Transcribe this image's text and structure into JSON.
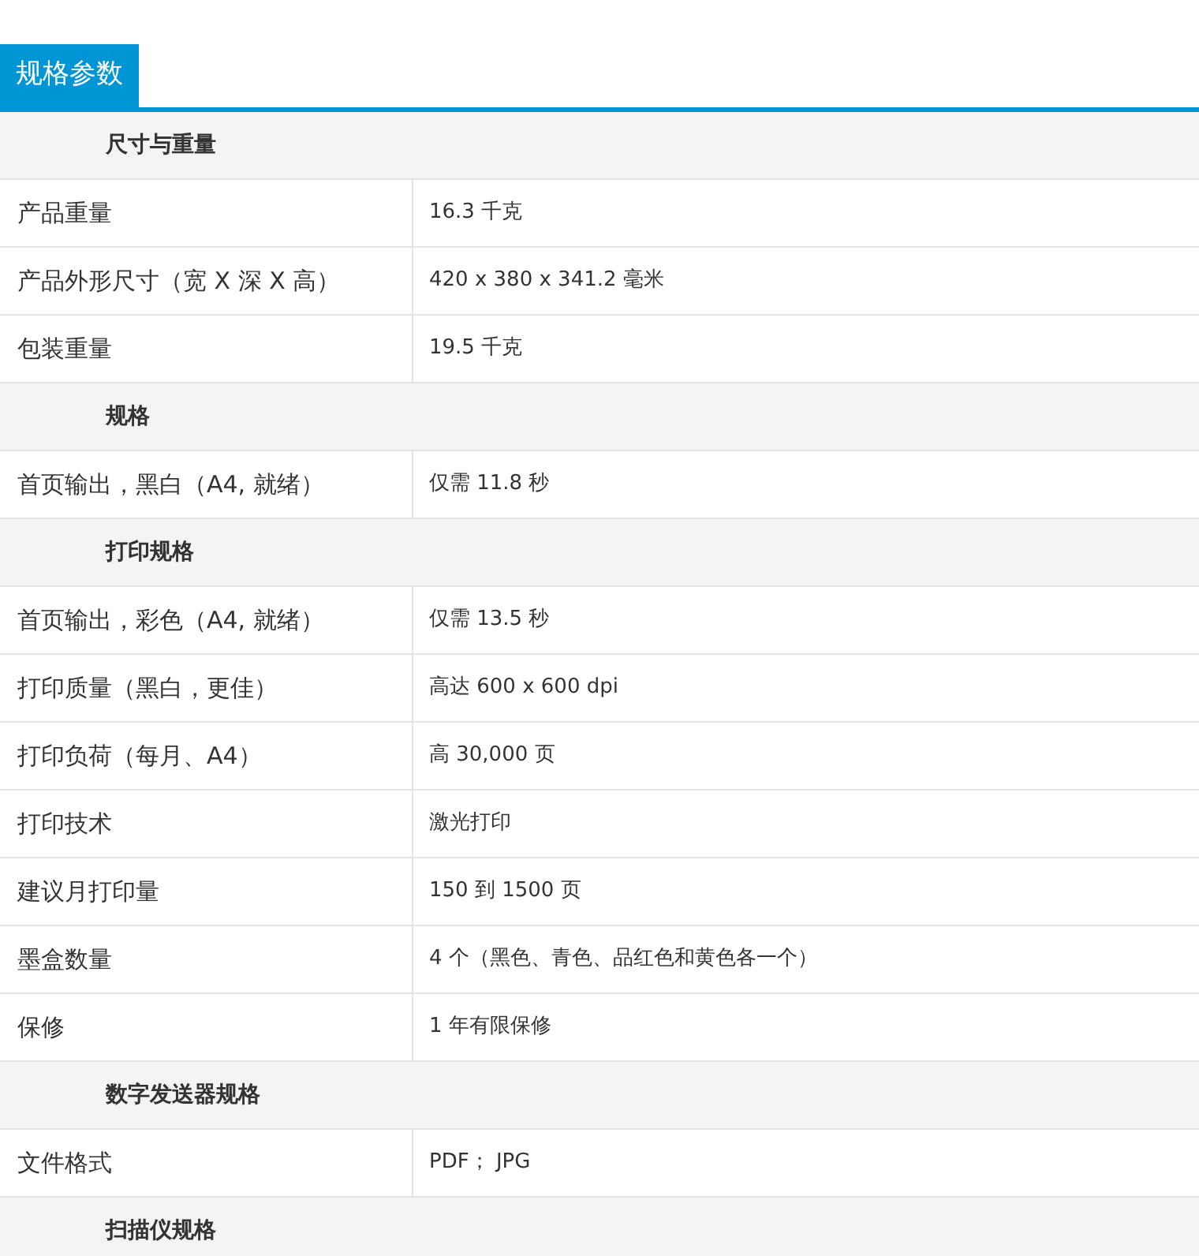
{
  "tab": {
    "label": "规格参数",
    "selected": true
  },
  "sections": [
    {
      "title": "尺寸与重量",
      "rows": [
        {
          "label": "产品重量",
          "value": "16.3 千克"
        },
        {
          "label": "产品外形尺寸（宽 X 深 X 高）",
          "value": "420 x 380 x 341.2 毫米"
        },
        {
          "label": "包装重量",
          "value": "19.5 千克"
        }
      ]
    },
    {
      "title": "规格",
      "rows": [
        {
          "label": "首页输出，黑白（A4, 就绪）",
          "value": "仅需 11.8 秒"
        }
      ]
    },
    {
      "title": "打印规格",
      "rows": [
        {
          "label": "首页输出，彩色（A4, 就绪）",
          "value": "仅需 13.5 秒"
        },
        {
          "label": "打印质量（黑白，更佳）",
          "value": "高达 600 x 600 dpi"
        },
        {
          "label": "打印负荷（每月、A4）",
          "value": "高 30,000 页"
        },
        {
          "label": "打印技术",
          "value": "激光打印"
        },
        {
          "label": "建议月打印量",
          "value": "150 到 1500 页"
        },
        {
          "label": "墨盒数量",
          "value": "4 个（黑色、青色、品红色和黄色各一个）"
        },
        {
          "label": "保修",
          "value": "1 年有限保修"
        }
      ]
    },
    {
      "title": "数字发送器规格",
      "rows": [
        {
          "label": "文件格式",
          "value": "PDF； JPG"
        }
      ]
    },
    {
      "title": "扫描仪规格"
    }
  ]
}
